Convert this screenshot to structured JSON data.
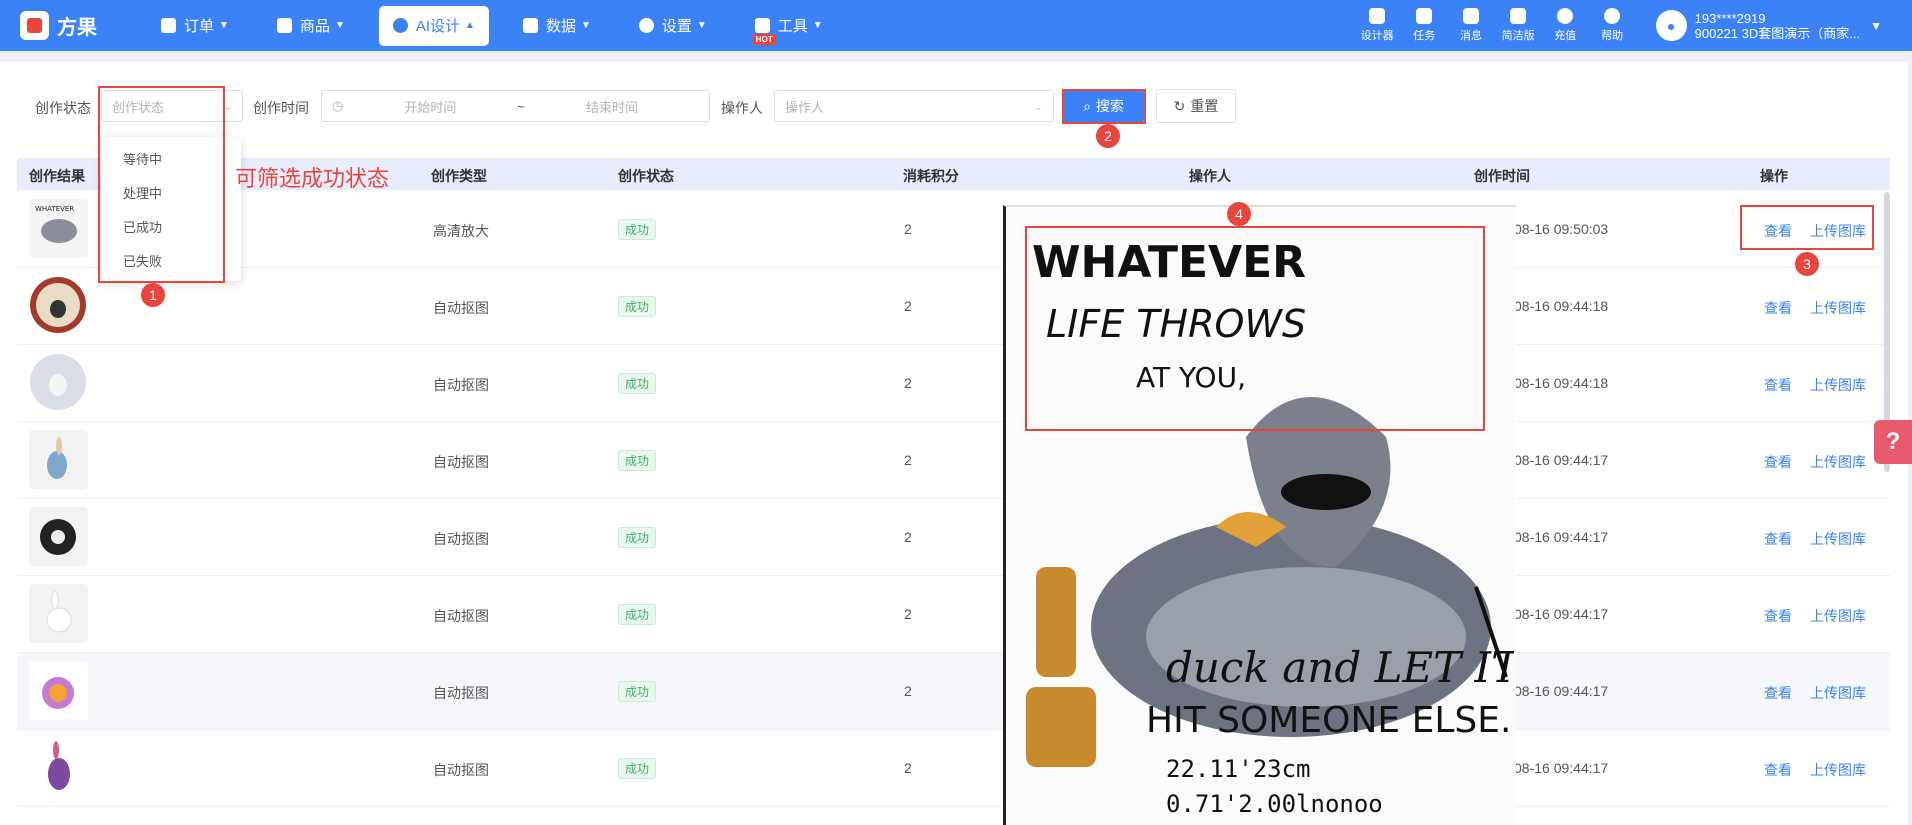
{
  "brand": {
    "name": "方果"
  },
  "nav": [
    {
      "label": "订单",
      "color": "#ffffff"
    },
    {
      "label": "商品",
      "color": "#ffffff"
    },
    {
      "label": "AI设计",
      "color": "#3b82f6"
    },
    {
      "label": "数据",
      "color": "#ffffff"
    },
    {
      "label": "设置",
      "color": "#ffffff"
    },
    {
      "label": "工具",
      "color": "#ffffff"
    }
  ],
  "hot_badge": "HOT",
  "tools": [
    "设计器",
    "任务",
    "消息",
    "简洁版",
    "充值",
    "帮助"
  ],
  "user": {
    "phone": "193****2919",
    "account": "900221 3D套图演示（商家..."
  },
  "filter": {
    "status_label": "创作状态",
    "status_placeholder": "创作状态",
    "time_label": "创作时间",
    "start_placeholder": "开始时间",
    "separator": "~",
    "end_placeholder": "结束时间",
    "operator_label": "操作人",
    "operator_placeholder": "操作人",
    "search_button": "搜索",
    "reset_button": "重置"
  },
  "dropdown": [
    "等待中",
    "处理中",
    "已成功",
    "已失败"
  ],
  "table": {
    "headers": [
      "创作结果",
      "创作类型",
      "创作状态",
      "消耗积分",
      "操作人",
      "创作时间",
      "操作"
    ],
    "rows": [
      {
        "type": "高清放大",
        "status": "成功",
        "points": "2",
        "time": "08-16 09:50:03"
      },
      {
        "type": "自动抠图",
        "status": "成功",
        "points": "2",
        "time": "08-16 09:44:18"
      },
      {
        "type": "自动抠图",
        "status": "成功",
        "points": "2",
        "time": "08-16 09:44:18"
      },
      {
        "type": "自动抠图",
        "status": "成功",
        "points": "2",
        "time": "08-16 09:44:17"
      },
      {
        "type": "自动抠图",
        "status": "成功",
        "points": "2",
        "time": "08-16 09:44:17"
      },
      {
        "type": "自动抠图",
        "status": "成功",
        "points": "2",
        "time": "08-16 09:44:17"
      },
      {
        "type": "自动抠图",
        "status": "成功",
        "points": "2",
        "time": "08-16 09:44:17"
      },
      {
        "type": "自动抠图",
        "status": "成功",
        "points": "2",
        "time": "08-16 09:44:17"
      }
    ],
    "view_link": "查看",
    "upload_link": "上传图库"
  },
  "annotations": {
    "filter_hint": "可筛选成功状态",
    "badges": [
      "1",
      "2",
      "3",
      "4"
    ]
  },
  "preview": {
    "line1": "WHATEVER",
    "line2": "LIFE THROWS",
    "line3": "AT YOU,",
    "line4": "duck and LET IT",
    "line5": "HIT SOMEONE ELSE.",
    "line6": "22.11'23cm",
    "line7": "0.71'2.00lnonoo"
  }
}
